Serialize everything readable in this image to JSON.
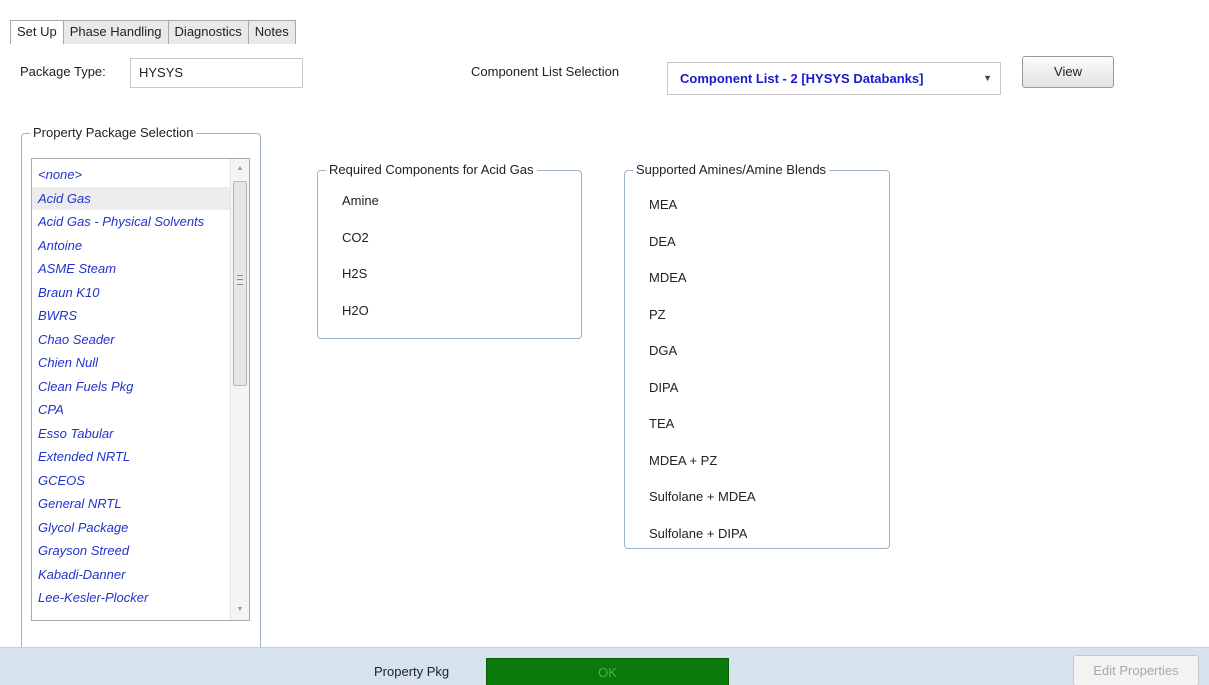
{
  "tabs": [
    "Set Up",
    "Phase Handling",
    "Diagnostics",
    "Notes"
  ],
  "package_type": {
    "label": "Package Type:",
    "value": "HYSYS"
  },
  "component_list": {
    "label": "Component List Selection",
    "selected": "Component List - 2 [HYSYS Databanks]",
    "view_button": "View"
  },
  "property_package_selection": {
    "title": "Property Package Selection",
    "items": [
      "<none>",
      "Acid Gas",
      "Acid Gas - Physical Solvents",
      "Antoine",
      "ASME Steam",
      "Braun K10",
      "BWRS",
      "Chao Seader",
      "Chien Null",
      "Clean Fuels Pkg",
      "CPA",
      "Esso Tabular",
      "Extended NRTL",
      "GCEOS",
      "General NRTL",
      "Glycol Package",
      "Grayson Streed",
      "Kabadi-Danner",
      "Lee-Kesler-Plocker"
    ],
    "selected_index": 1
  },
  "required_components": {
    "title": "Required Components for Acid Gas",
    "items": [
      "Amine",
      "CO2",
      "H2S",
      "H2O"
    ]
  },
  "supported_amines": {
    "title": "Supported Amines/Amine Blends",
    "items": [
      "MEA",
      "DEA",
      "MDEA",
      "PZ",
      "DGA",
      "DIPA",
      "TEA",
      "MDEA + PZ",
      "Sulfolane + MDEA",
      "Sulfolane + DIPA"
    ]
  },
  "footer": {
    "property_pkg_label": "Property Pkg",
    "status": "OK",
    "status_color": "#0a7a0a",
    "edit_properties": "Edit Properties"
  }
}
